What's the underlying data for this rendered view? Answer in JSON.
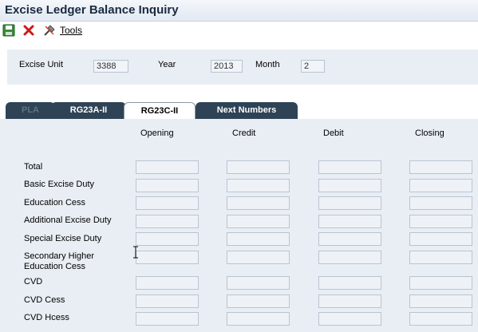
{
  "window": {
    "title": "Excise Ledger Balance Inquiry"
  },
  "toolbar": {
    "save_icon": "save-icon",
    "close_icon": "close-icon",
    "tools_icon": "tools-icon",
    "tools_label": "Tools"
  },
  "header": {
    "excise_unit_label": "Excise Unit",
    "excise_unit_value": "3388",
    "year_label": "Year",
    "year_value": "2013",
    "month_label": "Month",
    "month_value": "2"
  },
  "tabs": [
    {
      "label": "PLA",
      "active": false
    },
    {
      "label": "RG23A-II",
      "active": false
    },
    {
      "label": "RG23C-II",
      "active": true
    },
    {
      "label": "Next Numbers",
      "active": false
    }
  ],
  "grid": {
    "columns": [
      "Opening",
      "Credit",
      "Debit",
      "Closing"
    ],
    "rows": [
      "Total",
      "Basic Excise Duty",
      "Education Cess",
      "Additional Excise Duty",
      "Special Excise Duty",
      "Secondary Higher",
      "Education Cess",
      "CVD",
      "CVD Cess",
      "CVD Hcess"
    ]
  },
  "colors": {
    "tab_dark": "#2f4356",
    "panel_bg": "#e9eef4",
    "title_text": "#1a2b40"
  }
}
